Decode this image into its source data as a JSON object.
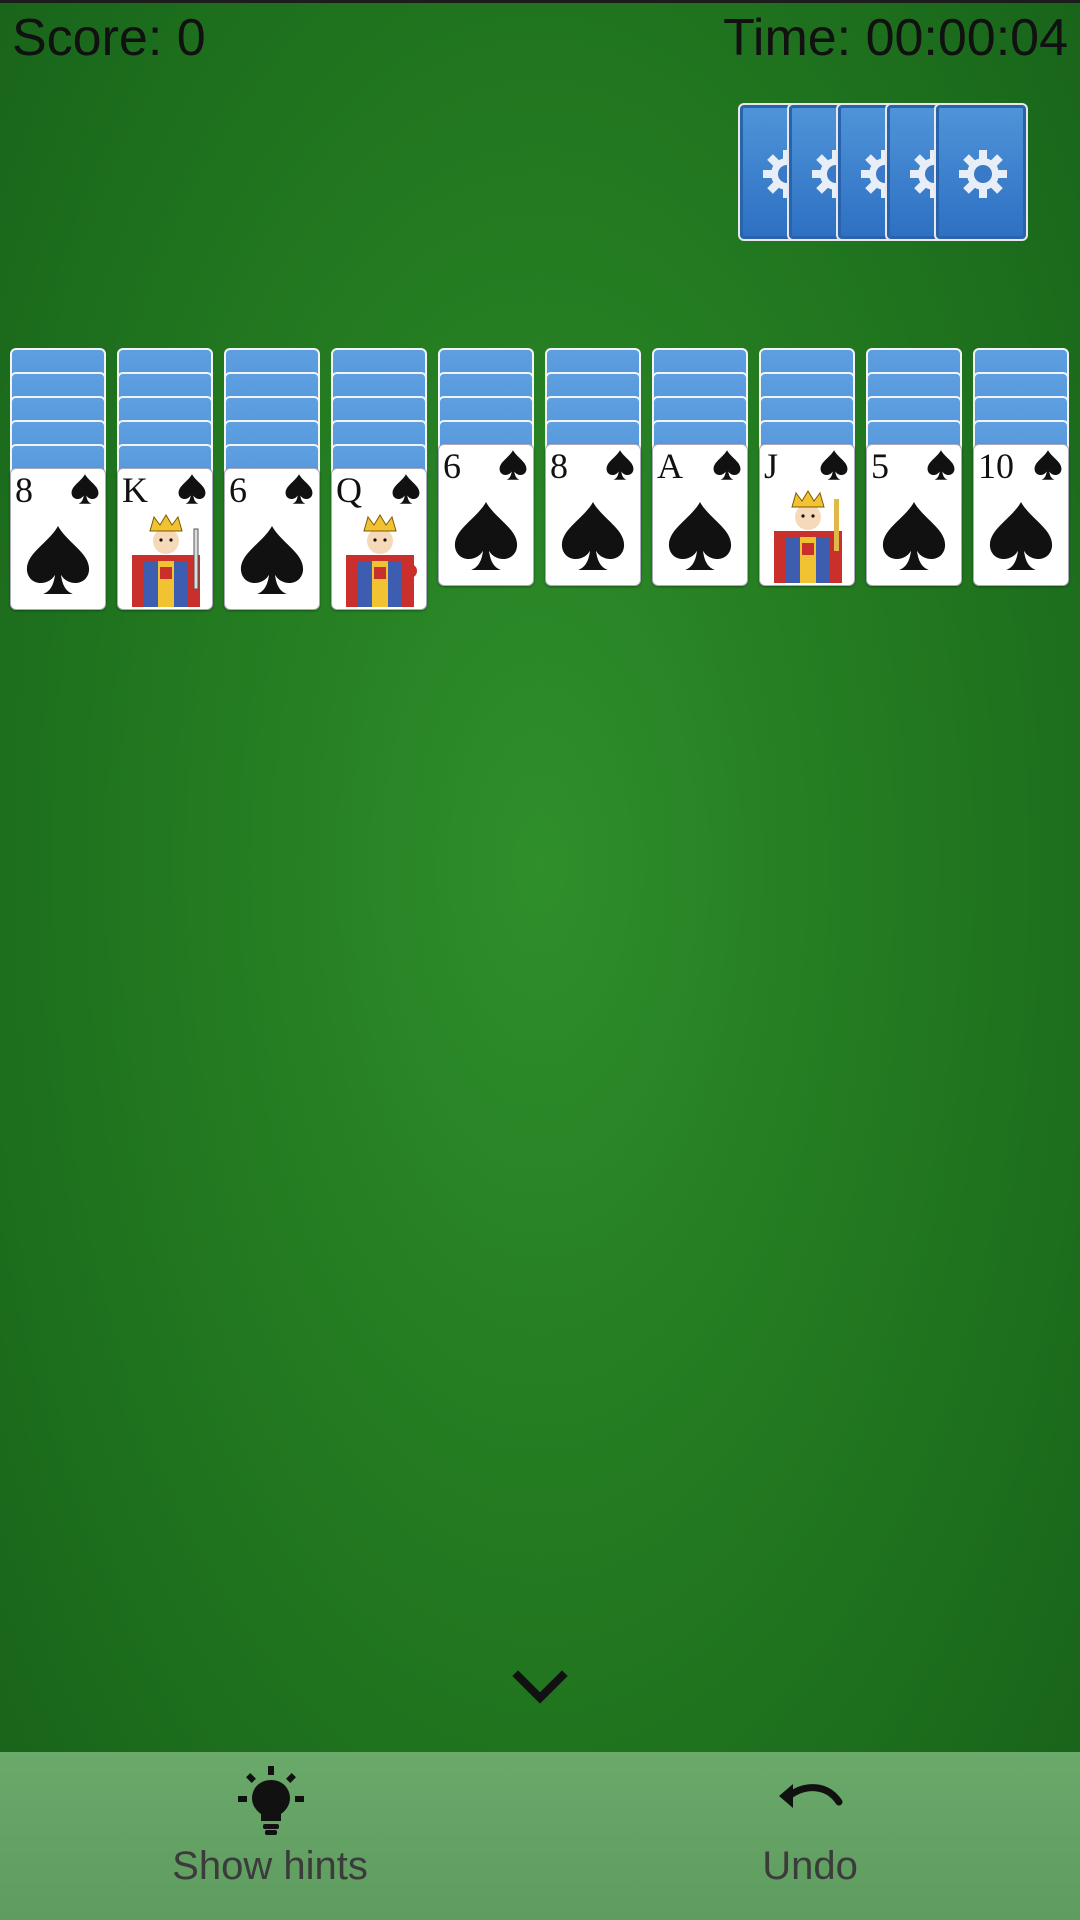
{
  "header": {
    "score": "Score: 0",
    "time": "Time: 00:00:04"
  },
  "stock": {
    "piles": 5,
    "icon": "gear-icon"
  },
  "tableau": [
    {
      "hidden": 5,
      "rank": "8",
      "suit": "spades",
      "court": false
    },
    {
      "hidden": 5,
      "rank": "K",
      "suit": "spades",
      "court": true
    },
    {
      "hidden": 5,
      "rank": "6",
      "suit": "spades",
      "court": false
    },
    {
      "hidden": 5,
      "rank": "Q",
      "suit": "spades",
      "court": true
    },
    {
      "hidden": 4,
      "rank": "6",
      "suit": "spades",
      "court": false
    },
    {
      "hidden": 4,
      "rank": "8",
      "suit": "spades",
      "court": false
    },
    {
      "hidden": 4,
      "rank": "A",
      "suit": "spades",
      "court": false
    },
    {
      "hidden": 4,
      "rank": "J",
      "suit": "spades",
      "court": true
    },
    {
      "hidden": 4,
      "rank": "5",
      "suit": "spades",
      "court": false
    },
    {
      "hidden": 4,
      "rank": "10",
      "suit": "spades",
      "court": false
    }
  ],
  "bottom": {
    "hints_label": "Show hints",
    "undo_label": "Undo"
  },
  "colors": {
    "felt": "#237a20",
    "card_back": "#3b7fd0",
    "bar": "#629f62"
  }
}
